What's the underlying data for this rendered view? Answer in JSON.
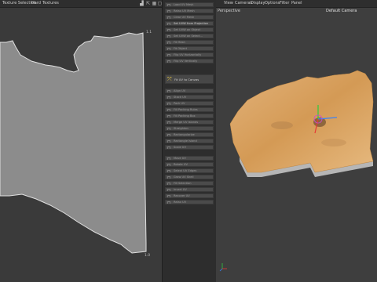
{
  "uv_editor": {
    "menu": [
      "Texture Selection",
      "Hard",
      "Textures"
    ],
    "toolbar_icons": [
      "chart-icon",
      "export-icon",
      "grid-icon",
      "close-icon"
    ],
    "axis_labels": {
      "top_right": "1.1",
      "bottom_right": "1.0"
    }
  },
  "command_panel": {
    "items": [
      {
        "label": "Load UV Mesh",
        "style": "small"
      },
      {
        "label": "Relax UV Mesh",
        "style": "small"
      },
      {
        "label": "Clear UV Mesh",
        "style": "small"
      },
      {
        "label": "Set UVW from Projection",
        "style": "small",
        "highlighted": true
      },
      {
        "label": "Set UVW on Object",
        "style": "small"
      },
      {
        "label": "Set UVW on Select...",
        "style": "small"
      },
      {
        "label": "Fit Mesh",
        "style": "small"
      },
      {
        "label": "Fit Object",
        "style": "small"
      },
      {
        "label": "Flip UV Horizontally",
        "style": "small"
      },
      {
        "label": "Flip UV Vertically",
        "style": "small"
      },
      {
        "label": "Fit UV to Canvas",
        "style": "big"
      },
      {
        "label": "Align UV",
        "style": "small"
      },
      {
        "label": "Stack UV",
        "style": "small"
      },
      {
        "label": "Pack UV",
        "style": "small"
      },
      {
        "label": "Fill Packing Rules",
        "style": "small"
      },
      {
        "label": "Fill Packing Box",
        "style": "small"
      },
      {
        "label": "Merge UV Islands",
        "style": "small"
      },
      {
        "label": "Straighten",
        "style": "small"
      },
      {
        "label": "Rectangularize",
        "style": "small"
      },
      {
        "label": "Rectangle Island",
        "style": "small"
      },
      {
        "label": "Scale UV",
        "style": "small"
      },
      {
        "label": "Move UV",
        "style": "small"
      },
      {
        "label": "Rotate UV",
        "style": "small"
      },
      {
        "label": "Select UV Edges",
        "style": "small"
      },
      {
        "label": "Grow UV Shell",
        "style": "small"
      },
      {
        "label": "Fill Selection",
        "style": "small"
      },
      {
        "label": "Invert UV",
        "style": "small"
      },
      {
        "label": "Recover UV",
        "style": "small"
      },
      {
        "label": "Relax UV",
        "style": "small"
      }
    ]
  },
  "viewport": {
    "menu": [
      "View",
      "Cameras",
      "Display",
      "Options",
      "Filter",
      "Panel"
    ],
    "label": "Perspective",
    "camera": "Default Camera"
  },
  "colors": {
    "uv_shape_fill": "#8c8c8c",
    "uv_shape_stroke": "#e0e0e0",
    "terrain_sand": "#d9a462",
    "terrain_side": "#b6b6b6"
  }
}
